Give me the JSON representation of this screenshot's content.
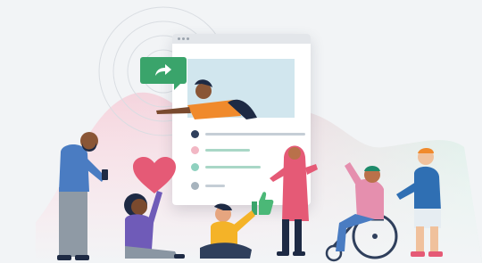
{
  "scene": {
    "colors": {
      "background": "#f2f4f6",
      "accent_green": "#3aa46b",
      "accent_pink": "#e55a76",
      "window_banner": "#d1e6ee",
      "bullet_navy": "#2f3f5c",
      "bullet_pink": "#f2b7c4",
      "bullet_teal": "#8fd1bf",
      "bullet_gray": "#a6b3bd",
      "bar_green": "#a9d7c6",
      "bar_gray": "#c5ced6"
    },
    "icons": [
      "share-arrow-icon",
      "heart-icon",
      "thumbs-up-icon"
    ],
    "people": [
      "man-with-phone",
      "woman-holding-heart",
      "person-sitting-thumbs-up",
      "woman-in-hijab",
      "man-in-wheelchair",
      "person-pushing-wheelchair",
      "man-reaching-from-screen"
    ]
  }
}
